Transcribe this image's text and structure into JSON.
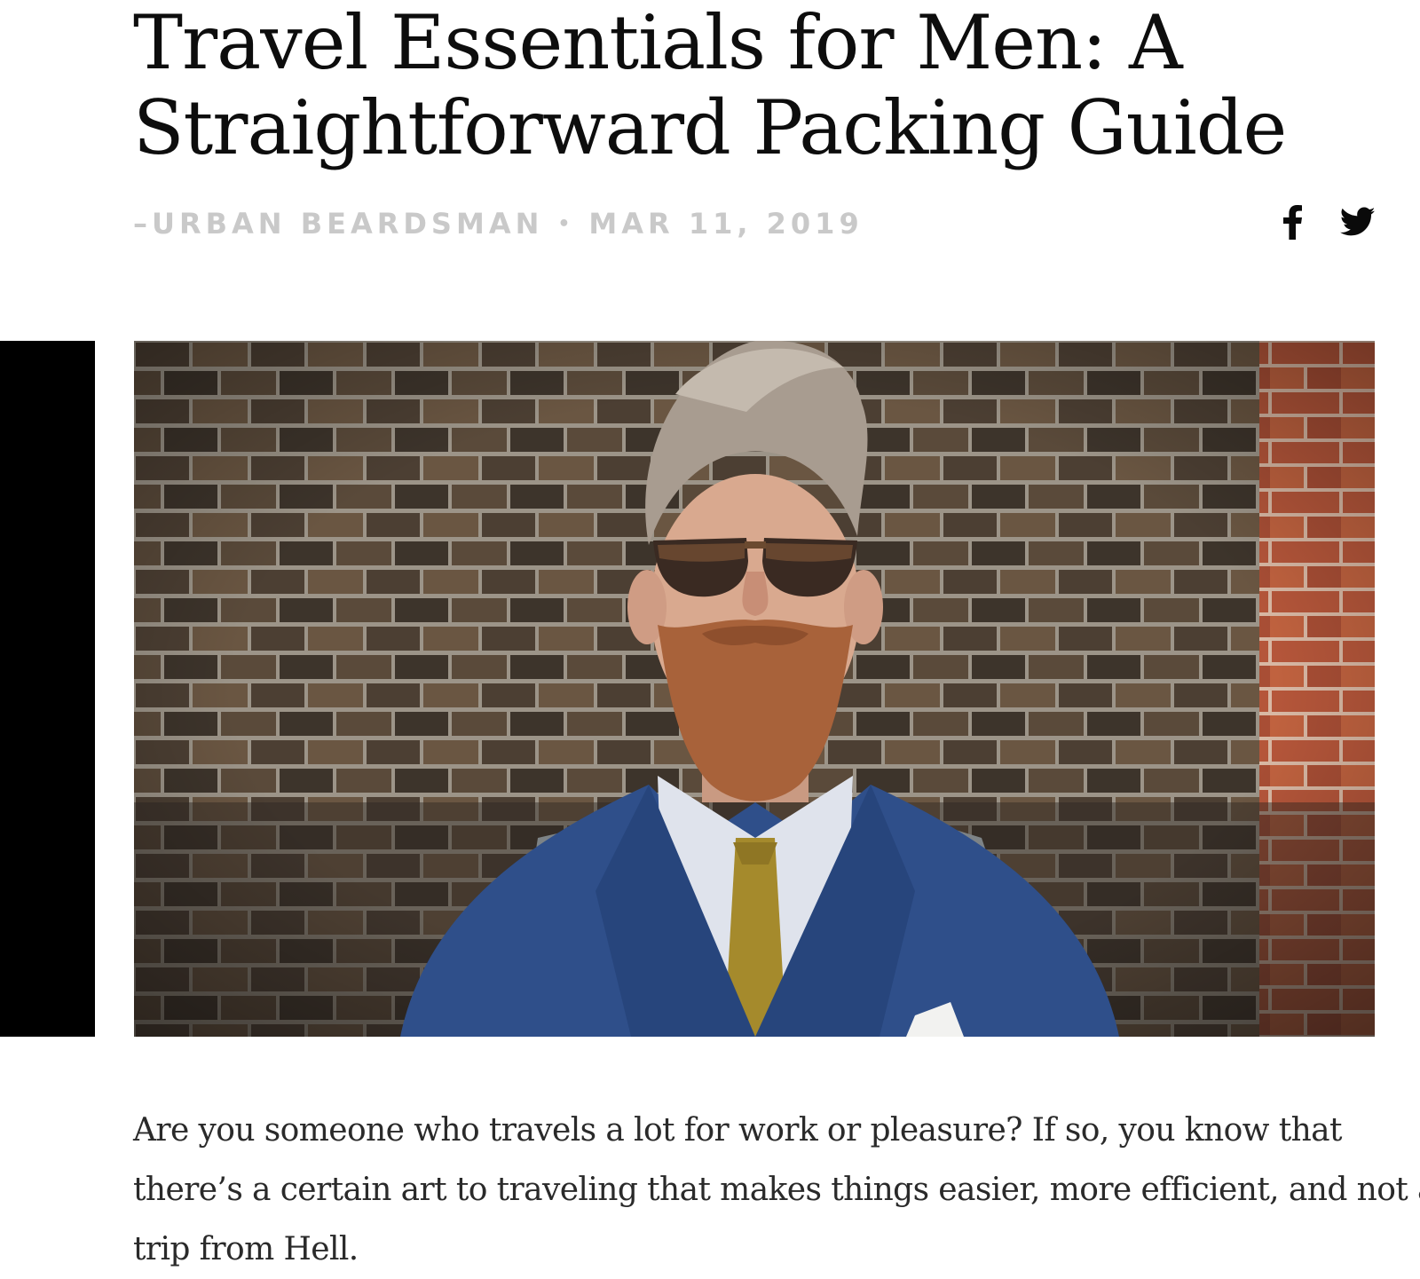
{
  "article": {
    "title_lines": [
      "Travel Essentials for Men: A",
      "Straightforward Packing Guide"
    ],
    "author": "–URBAN BEARDSMAN",
    "separator": "•",
    "date": "MAR 11, 2019",
    "share": {
      "icons": [
        "facebook-icon",
        "twitter-icon"
      ]
    },
    "hero_image": {
      "icon": "bearded-man-photo"
    },
    "body_lines": [
      "Are you someone who travels a lot for work or pleasure? If so, you know that",
      "there’s a certain art to traveling that makes things easier, more efficient, and not a",
      "trip from Hell."
    ]
  },
  "colors": {
    "text": "#111111",
    "byline": "#c9c9c9",
    "body": "#2a2a2a",
    "sidebar": "#000000"
  }
}
